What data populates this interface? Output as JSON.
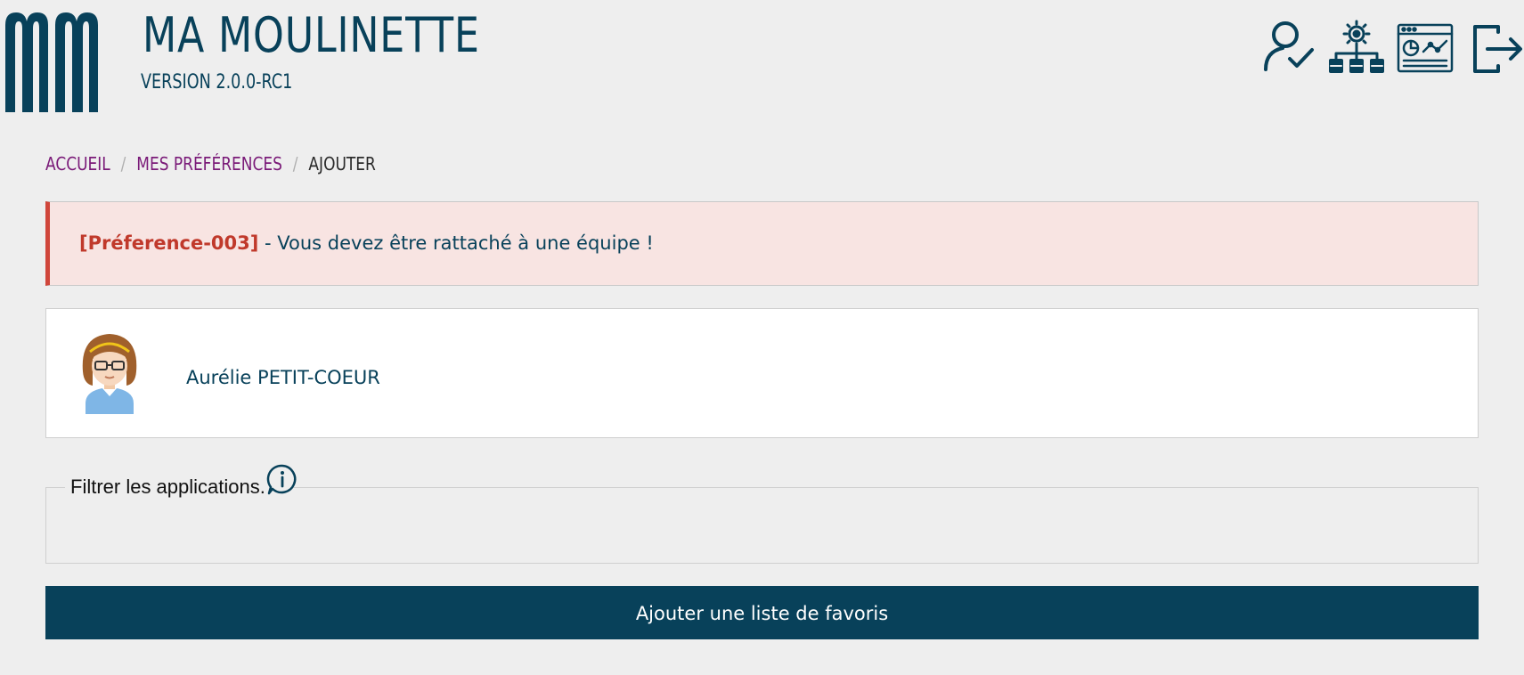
{
  "header": {
    "title": "MA MOULINETTE",
    "version": "VERSION 2.0.0-RC1",
    "icons": [
      "user-check-icon",
      "settings-network-icon",
      "dashboard-window-icon",
      "logout-icon"
    ]
  },
  "breadcrumb": {
    "items": [
      "ACCUEIL",
      "MES PRÉFÉRENCES"
    ],
    "current": "AJOUTER",
    "separator": "/"
  },
  "alert": {
    "code": "[Préference-003]",
    "message": " - Vous devez être rattaché à une équipe !"
  },
  "user": {
    "name": "Aurélie PETIT-COEUR",
    "avatar_icon": "girl-avatar-icon"
  },
  "filter": {
    "legend": "Filtrer les applications.",
    "help_icon": "info-icon"
  },
  "actions": {
    "submit_label": "Ajouter une liste de favoris"
  },
  "colors": {
    "primary": "#08415a",
    "breadcrumb_link": "#7a1a78",
    "alert_background": "#f8e4e2",
    "alert_accent": "#d0463b",
    "page_background": "#eeeeee"
  }
}
